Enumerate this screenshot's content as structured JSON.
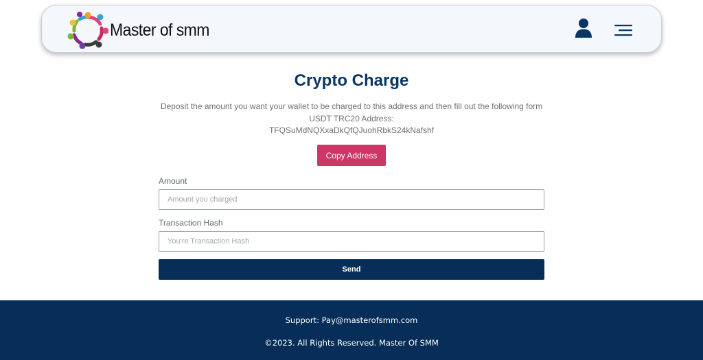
{
  "header": {
    "logo_text": "Master of smm",
    "icons": {
      "logo": "people-circle-logo-icon",
      "account": "user-icon",
      "menu": "hamburger-menu-icon"
    },
    "logo_colors": [
      "#f0a030",
      "#e0457a",
      "#c8285a",
      "#8a2a88",
      "#6a3fa0",
      "#3b3b3b",
      "#7bb540",
      "#3aa0d8",
      "#f2c12e"
    ]
  },
  "main": {
    "title": "Crypto Charge",
    "description": "Deposit the amount you want your wallet to be charged to this address and then fill out the following form",
    "address_label": "USDT TRC20 Address:",
    "address": "TFQSuMdNQXxaDkQfQJuohRbkS24kNafshf",
    "copy_button": "Copy Address",
    "amount_label": "Amount",
    "amount_placeholder": "Amount you charged",
    "amount_value": "",
    "hash_label": "Transaction Hash",
    "hash_placeholder": "You're Transaction Hash",
    "hash_value": "",
    "send_button": "Send"
  },
  "footer": {
    "support": "Support: Pay@masterofsmm.com",
    "copyright": "©2023. All Rights Reserved. Master Of SMM"
  },
  "colors": {
    "title": "#0b3562",
    "copy_button": "#cc3766",
    "send_button": "#062e59",
    "footer_bg": "#062e59",
    "header_bg": "#f4f8fd"
  }
}
